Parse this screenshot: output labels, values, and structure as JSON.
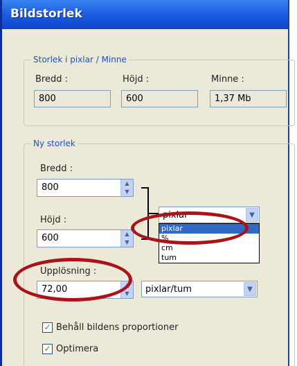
{
  "window": {
    "title": "Bildstorlek"
  },
  "current_size": {
    "legend": "Storlek i pixlar / Minne",
    "width_label": "Bredd :",
    "width_value": "800",
    "height_label": "Höjd :",
    "height_value": "600",
    "memory_label": "Minne :",
    "memory_value": "1,37 Mb"
  },
  "new_size": {
    "legend": "Ny storlek",
    "width_label": "Bredd :",
    "width_value": "800",
    "height_label": "Höjd :",
    "height_value": "600",
    "resolution_label": "Upplösning :",
    "resolution_value": "72,00",
    "unit_selected": "pixlar",
    "unit_options": [
      "pixlar",
      "%",
      "cm",
      "tum"
    ],
    "resolution_unit": "pixlar/tum"
  },
  "options": {
    "keep_proportions_label": "Behåll bildens proportioner",
    "keep_proportions_checked": true,
    "optimize_label": "Optimera",
    "optimize_checked": true
  },
  "annotations": {
    "highlight_color": "#A8141A"
  }
}
